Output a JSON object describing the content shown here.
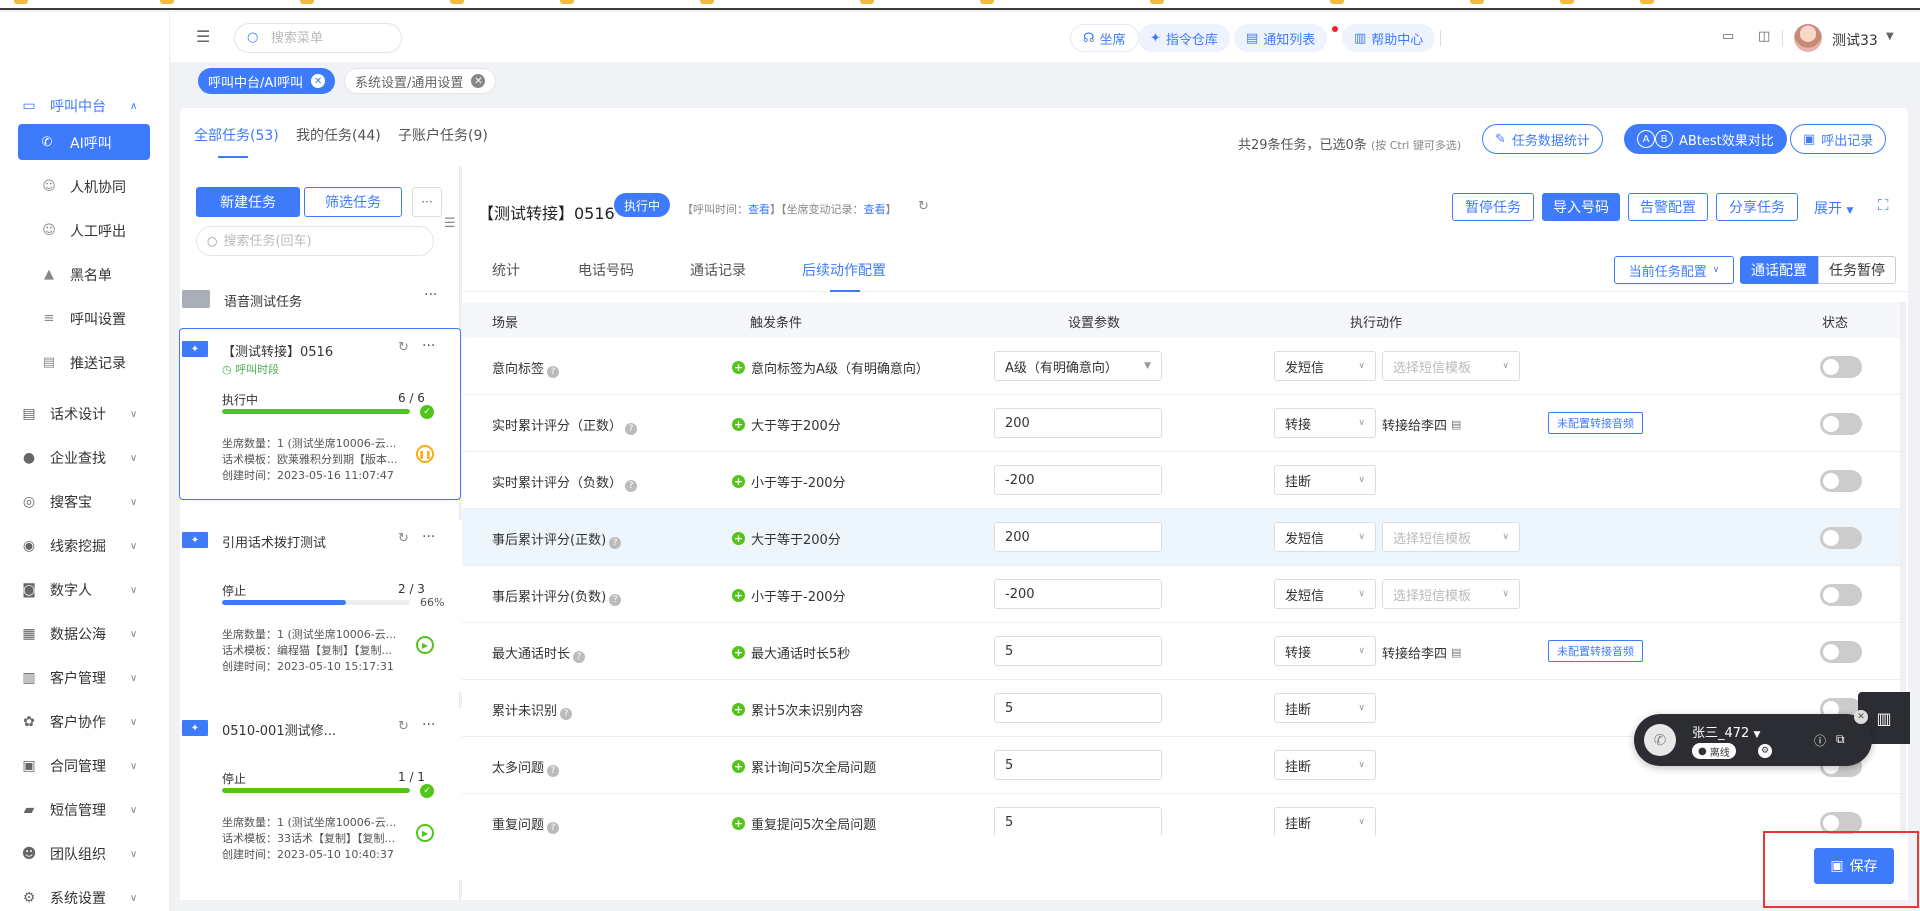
{
  "header": {
    "search_placeholder": "搜索菜单",
    "buttons": [
      "坐席",
      "指令仓库",
      "通知列表",
      "帮助中心"
    ],
    "user_name": "测试33"
  },
  "sidebar": {
    "groups": [
      {
        "label": "呼叫中台",
        "icon": "monitor-icon",
        "open": true
      },
      {
        "label": "话术设计",
        "icon": "script-icon"
      },
      {
        "label": "企业查找",
        "icon": "bulb-icon"
      },
      {
        "label": "搜客宝",
        "icon": "magnifier-icon"
      },
      {
        "label": "线索挖掘",
        "icon": "target-icon"
      },
      {
        "label": "数字人",
        "icon": "robot-icon"
      },
      {
        "label": "数据公海",
        "icon": "chart-icon"
      },
      {
        "label": "客户管理",
        "icon": "customer-icon"
      },
      {
        "label": "客户协作",
        "icon": "cooperate-icon"
      },
      {
        "label": "合同管理",
        "icon": "contract-icon"
      },
      {
        "label": "短信管理",
        "icon": "sms-icon"
      },
      {
        "label": "团队组织",
        "icon": "team-icon"
      },
      {
        "label": "系统设置",
        "icon": "settings-icon"
      }
    ],
    "sub_items": [
      {
        "label": "AI呼叫",
        "icon": "phone-icon",
        "active": true
      },
      {
        "label": "人机协同",
        "icon": "user-robot-icon"
      },
      {
        "label": "人工呼出",
        "icon": "user-icon"
      },
      {
        "label": "黑名单",
        "icon": "warning-icon"
      },
      {
        "label": "呼叫设置",
        "icon": "sliders-icon"
      },
      {
        "label": "推送记录",
        "icon": "record-icon"
      }
    ]
  },
  "tags": [
    {
      "label": "呼叫中台/AI呼叫",
      "active": true
    },
    {
      "label": "系统设置/通用设置",
      "active": false
    }
  ],
  "task_tabs": [
    "全部任务(53)",
    "我的任务(44)",
    "子账户任务(9)"
  ],
  "task_summary": {
    "text": "共29条任务，已选0条",
    "hint": "(按 Ctrl 键可多选)"
  },
  "task_buttons": [
    "任务数据统计",
    "ABtest效果对比",
    "呼出记录"
  ],
  "task_list": {
    "new_button": "新建任务",
    "filter_button": "筛选任务",
    "search_placeholder": "搜索任务(回车)",
    "folder": "语音测试任务",
    "cards": [
      {
        "title": "【测试转接】0516",
        "time_label": "呼叫时段",
        "status": "执行中",
        "count": "6 / 6",
        "progress": 1.0,
        "bar_color": "#52c41a",
        "seats": "坐席数量：1 (测试坐席10006-云...",
        "template": "话术模板：欧莱雅积分到期【版本...",
        "created": "创建时间：2023-05-16 11:07:47",
        "selected": true
      },
      {
        "title": "引用话术拨打测试",
        "status": "停止",
        "count": "2 / 3",
        "progress": 0.66,
        "percent": "66%",
        "bar_color": "#3e7bfa",
        "seats": "坐席数量：1 (测试坐席10006-云...",
        "template": "话术模板：编程猫【复制】【复制...",
        "created": "创建时间：2023-05-10 15:17:31"
      },
      {
        "title": "0510-001测试修...",
        "status": "停止",
        "count": "1 / 1",
        "progress": 1.0,
        "bar_color": "#52c41a",
        "seats": "坐席数量：1 (测试坐席10006-云...",
        "template": "话术模板：33话术【复制】【复制...",
        "created": "创建时间：2023-05-10 10:40:37"
      }
    ]
  },
  "main": {
    "title": "【测试转接】0516",
    "status_badge": "执行中",
    "info_prefix1": "【呼叫时间：",
    "info_link1": "查看",
    "info_mid": "】【坐席变动记录：",
    "info_link2": "查看",
    "info_suffix": "】",
    "buttons": [
      "暂停任务",
      "导入号码",
      "告警配置",
      "分享任务"
    ],
    "expand": "展开",
    "sub_tabs": [
      "统计",
      "电话号码",
      "通话记录",
      "后续动作配置"
    ],
    "config_dropdown": "当前任务配置",
    "seg_on": "通话配置",
    "seg_off": "任务暂停",
    "columns": [
      "场景",
      "触发条件",
      "设置参数",
      "执行动作",
      "状态"
    ],
    "rows": [
      {
        "scene": "意向标签",
        "help": true,
        "condition": "意向标签为A级（有明确意向）",
        "param": "A级（有明确意向）",
        "param_dropdown": true,
        "action": "发短信",
        "extra": "template",
        "template_placeholder": "选择短信模板"
      },
      {
        "scene": "实时累计评分（正数）",
        "help": true,
        "condition": "大于等于200分",
        "param": "200",
        "action": "转接",
        "extra": "transfer",
        "transfer_to": "转接给李四",
        "transfer_btn": "未配置转接音频"
      },
      {
        "scene": "实时累计评分（负数）",
        "help": true,
        "condition": "小于等于-200分",
        "param": "-200",
        "action": "挂断",
        "extra": "none"
      },
      {
        "scene": "事后累计评分(正数)",
        "help": true,
        "condition": "大于等于200分",
        "param": "200",
        "action": "发短信",
        "extra": "template",
        "template_placeholder": "选择短信模板",
        "highlight": true
      },
      {
        "scene": "事后累计评分(负数)",
        "help": true,
        "condition": "小于等于-200分",
        "param": "-200",
        "action": "发短信",
        "extra": "template",
        "template_placeholder": "选择短信模板"
      },
      {
        "scene": "最大通话时长",
        "help": true,
        "condition": "最大通话时长5秒",
        "param": "5",
        "action": "转接",
        "extra": "transfer",
        "transfer_to": "转接给李四",
        "transfer_btn": "未配置转接音频"
      },
      {
        "scene": "累计未识别",
        "help": true,
        "condition": "累计5次未识别内容",
        "param": "5",
        "action": "挂断",
        "extra": "none"
      },
      {
        "scene": "太多问题",
        "help": true,
        "condition": "累计询问5次全局问题",
        "param": "5",
        "action": "挂断",
        "extra": "none"
      },
      {
        "scene": "重复问题",
        "help": true,
        "condition": "重复提问5次全局问题",
        "param": "5",
        "action": "挂断",
        "extra": "none"
      }
    ],
    "save_button": "保存"
  },
  "call_widget": {
    "name": "张三_472",
    "status": "离线"
  },
  "colors": {
    "accent": "#3e7bfa",
    "success": "#52c41a",
    "warning": "#faad14",
    "highlight_border": "#e53935"
  }
}
